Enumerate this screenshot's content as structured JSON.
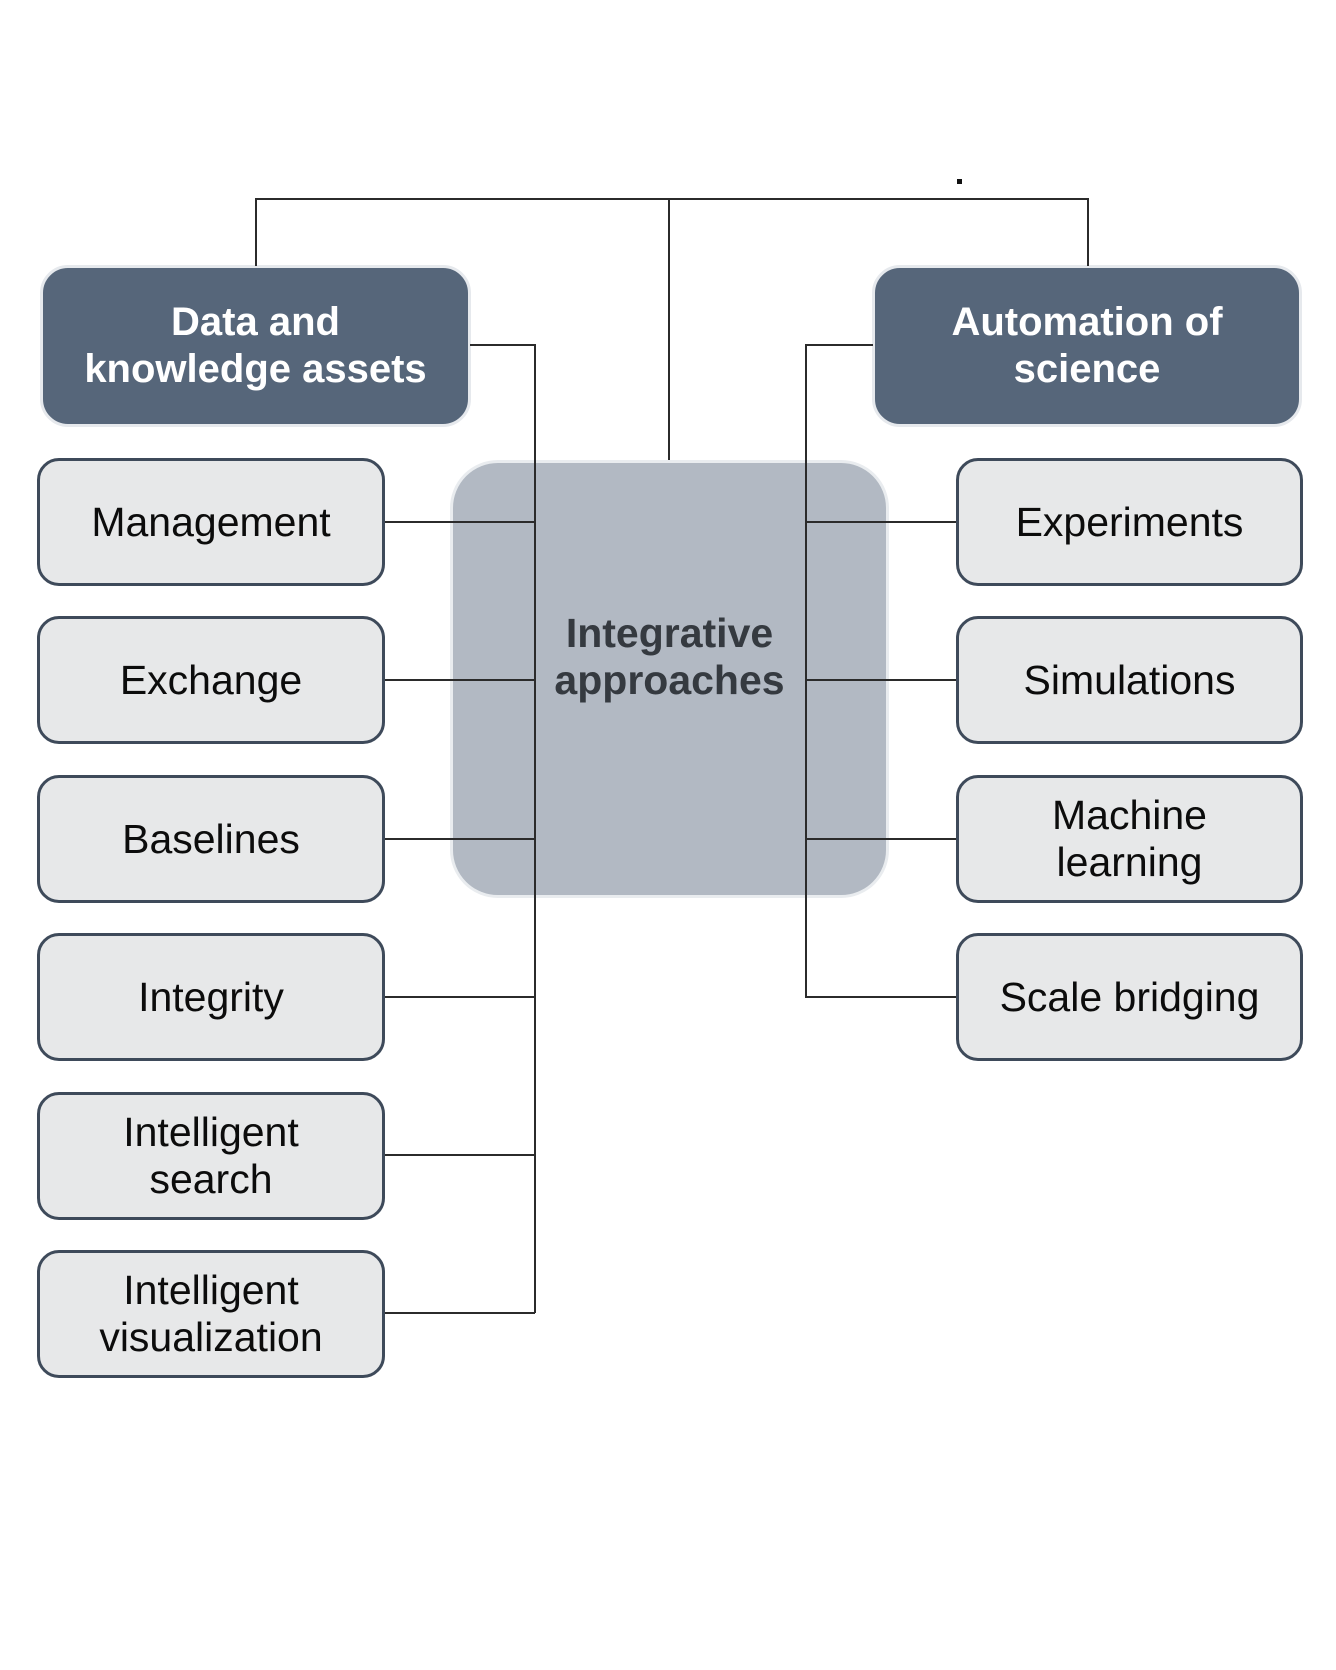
{
  "diagram": {
    "headers": {
      "left": {
        "line1": "Data and",
        "line2": "knowledge assets"
      },
      "right": {
        "line1": "Automation of",
        "line2": "science"
      }
    },
    "center": {
      "line1": "Integrative",
      "line2": "approaches"
    },
    "left_items": [
      {
        "line1": "Management",
        "line2": ""
      },
      {
        "line1": "Exchange",
        "line2": ""
      },
      {
        "line1": "Baselines",
        "line2": ""
      },
      {
        "line1": "Integrity",
        "line2": ""
      },
      {
        "line1": "Intelligent",
        "line2": "search"
      },
      {
        "line1": "Intelligent",
        "line2": "visualization"
      }
    ],
    "right_items": [
      {
        "line1": "Experiments",
        "line2": ""
      },
      {
        "line1": "Simulations",
        "line2": ""
      },
      {
        "line1": "Machine",
        "line2": "learning"
      },
      {
        "line1": "Scale bridging",
        "line2": ""
      }
    ],
    "colors": {
      "header_fill": "#56667a",
      "center_fill": "#b2b9c3",
      "leaf_fill": "#e7e8e9",
      "leaf_border": "#3e4a5a",
      "connector": "#2b2b2b"
    }
  }
}
